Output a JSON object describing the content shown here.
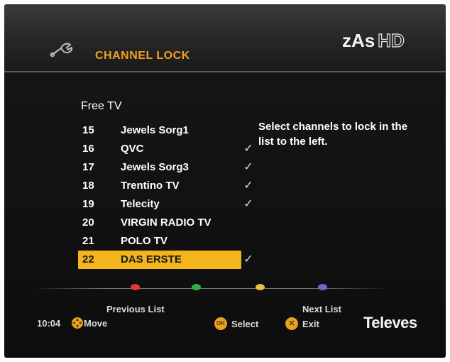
{
  "header": {
    "title": "CHANNEL LOCK",
    "brand_main": "zAs",
    "brand_suffix": "HD"
  },
  "list": {
    "section": "Free TV",
    "channels": [
      {
        "num": "15",
        "name": "Jewels Sorg1",
        "locked": false
      },
      {
        "num": "16",
        "name": "QVC",
        "locked": true
      },
      {
        "num": "17",
        "name": "Jewels Sorg3",
        "locked": true
      },
      {
        "num": "18",
        "name": "Trentino TV",
        "locked": true
      },
      {
        "num": "19",
        "name": "Telecity",
        "locked": true
      },
      {
        "num": "20",
        "name": "VIRGIN RADIO TV",
        "locked": false
      },
      {
        "num": "21",
        "name": "POLO TV",
        "locked": false
      },
      {
        "num": "22",
        "name": "DAS ERSTE",
        "locked": true
      }
    ],
    "selected_index": 7,
    "check_glyph": "✓"
  },
  "help_text": "Select channels to lock in the list to the left.",
  "footer": {
    "prev_list": "Previous List",
    "next_list": "Next List",
    "time": "10:04",
    "move": "Move",
    "select": "Select",
    "ok_icon_text": "OK",
    "exit": "Exit",
    "exit_icon_text": "✕",
    "logo": "Televes",
    "color_keys": [
      "#e0383a",
      "#2bb047",
      "#e7c33b",
      "#6f67d8"
    ]
  },
  "colors": {
    "accent": "#f3b41c",
    "title": "#f0a020"
  }
}
